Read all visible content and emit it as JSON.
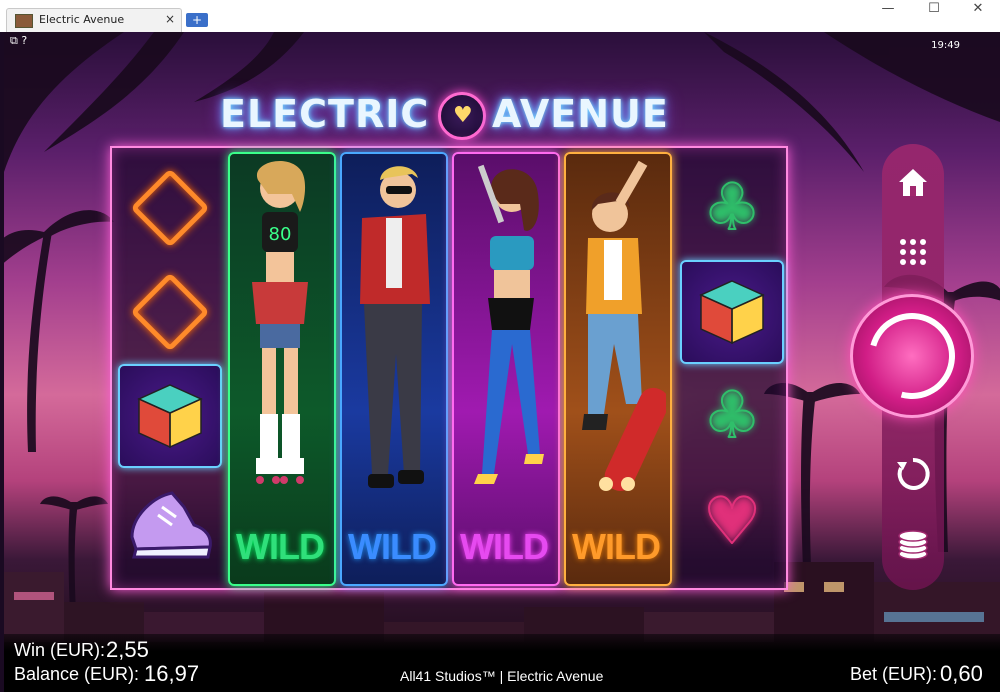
{
  "window": {
    "tab_title": "Electric Avenue",
    "tab_close": "×",
    "new_tab": "+",
    "minimize": "—",
    "maximize": "☐",
    "close": "✕"
  },
  "game": {
    "clock": "19:49",
    "top_icons": "⧉ ?",
    "logo_left": "ELECTRIC",
    "logo_right": "AVENUE",
    "reels": [
      {
        "type": "symbols",
        "symbols": [
          "diamond",
          "diamond",
          "cube",
          "sneaker"
        ]
      },
      {
        "type": "wild",
        "character": "roller-girl",
        "label": "WILD",
        "color": "#2fe07a",
        "border": "#3aff8a"
      },
      {
        "type": "wild",
        "character": "red-jacket-guy",
        "label": "WILD",
        "color": "#3a8cff",
        "border": "#4aa8ff"
      },
      {
        "type": "wild",
        "character": "singer-girl",
        "label": "WILD",
        "color": "#e64af0",
        "border": "#ff6af0"
      },
      {
        "type": "wild",
        "character": "skater-guy",
        "label": "WILD",
        "color": "#ff9a2a",
        "border": "#ffb040"
      },
      {
        "type": "symbols",
        "symbols": [
          "club",
          "cube",
          "club",
          "heart"
        ]
      }
    ],
    "controls": {
      "home": "home-icon",
      "menu": "grid-icon",
      "spin": "spin-icon",
      "autoplay": "autoplay-icon",
      "bet": "coins-icon"
    }
  },
  "footer": {
    "win_label": "Win (EUR):",
    "win_value": "2,55",
    "balance_label": "Balance (EUR):",
    "balance_value": "16,97",
    "studio": "All41 Studios™ | Electric Avenue",
    "bet_label": "Bet (EUR):",
    "bet_value": "0,60"
  },
  "colors": {
    "accent": "#ff5fd8",
    "spin": "#d11d86"
  }
}
